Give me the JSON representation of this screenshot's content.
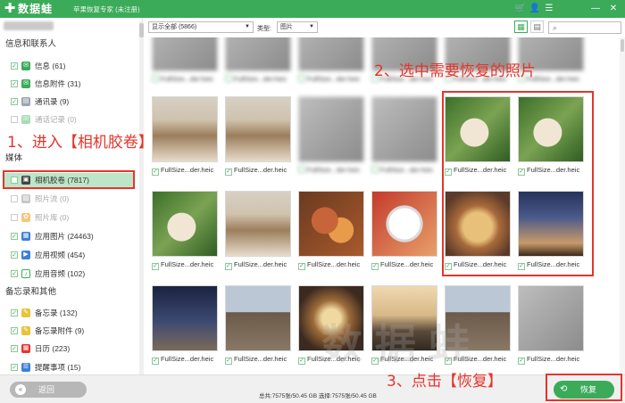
{
  "app": {
    "name": "数据蛙",
    "subtitle": "苹果恢复专家 (未注册)",
    "toolbar_icons": [
      "cart-icon",
      "user-icon",
      "menu-icon",
      "minimize-icon",
      "close-icon"
    ]
  },
  "sidebar": {
    "device_name": "",
    "sections": [
      {
        "title": "信息和联系人"
      },
      {
        "title": "媒体"
      },
      {
        "title": "备忘录和其他"
      }
    ],
    "items": [
      {
        "label": "信息 (61)",
        "icon": "message-icon",
        "color": "#3bab5a",
        "checked": true,
        "enabled": true
      },
      {
        "label": "信息附件 (31)",
        "icon": "attachment-icon",
        "color": "#3bab5a",
        "checked": true,
        "enabled": true
      },
      {
        "label": "通讯录 (9)",
        "icon": "contacts-icon",
        "color": "#9aa4ad",
        "checked": true,
        "enabled": true
      },
      {
        "label": "通话记录 (0)",
        "icon": "call-log-icon",
        "color": "#3bab5a",
        "checked": false,
        "enabled": false
      },
      {
        "label": "相机胶卷 (7817)",
        "icon": "camera-roll-icon",
        "color": "#444444",
        "checked": false,
        "enabled": true,
        "selected": true
      },
      {
        "label": "照片流 (0)",
        "icon": "photo-stream-icon",
        "color": "#c8c8c8",
        "checked": false,
        "enabled": false
      },
      {
        "label": "照片库 (0)",
        "icon": "photo-library-icon",
        "color": "#e8a33c",
        "checked": false,
        "enabled": false
      },
      {
        "label": "应用图片 (24463)",
        "icon": "app-photos-icon",
        "color": "#3d7fd8",
        "checked": true,
        "enabled": true
      },
      {
        "label": "应用视频 (454)",
        "icon": "app-videos-icon",
        "color": "#3d7fd8",
        "checked": true,
        "enabled": true
      },
      {
        "label": "应用音频 (102)",
        "icon": "app-audio-icon",
        "color": "#3bab5a",
        "checked": true,
        "enabled": true
      },
      {
        "label": "备忘录 (132)",
        "icon": "notes-icon",
        "color": "#e8c33c",
        "checked": true,
        "enabled": true
      },
      {
        "label": "备忘录附件 (9)",
        "icon": "notes-attachment-icon",
        "color": "#e8c33c",
        "checked": true,
        "enabled": true
      },
      {
        "label": "日历 (223)",
        "icon": "calendar-icon",
        "color": "#e4352b",
        "checked": true,
        "enabled": true
      },
      {
        "label": "提醒事项 (15)",
        "icon": "reminders-icon",
        "color": "#3d7fd8",
        "checked": true,
        "enabled": true
      }
    ]
  },
  "filters": {
    "show_select": "显示全部 (5866)",
    "type_label": "类型:",
    "type_select": "图片",
    "search_placeholder": ""
  },
  "grid": {
    "caption": "FullSize...der.heic",
    "selected_cells": [
      "r2c5",
      "r2c6",
      "r3c5",
      "r3c6"
    ],
    "photo_colors": {
      "coffee": [
        "#e8dccb",
        "#b7a186",
        "#ffffff"
      ],
      "green": [
        "#5a8a3e",
        "#2f5d22"
      ],
      "night": [
        "#1e2a4a",
        "#47507a"
      ]
    }
  },
  "bottom": {
    "back_label": "返回",
    "stats": "总共:7575张/50.45 GB 选择:7575张/50.45 GB",
    "recover_label": "恢复"
  },
  "annotations": {
    "step1": "1、进入【相机胶卷】",
    "step2": "2、选中需要恢复的照片",
    "step3": "3、点击【恢复】",
    "color": "#e4352b"
  },
  "watermark": "数据蛙",
  "colors": {
    "brand": "#3bab5a",
    "selected_item": "#bde6c8",
    "annotation": "#e4352b"
  }
}
